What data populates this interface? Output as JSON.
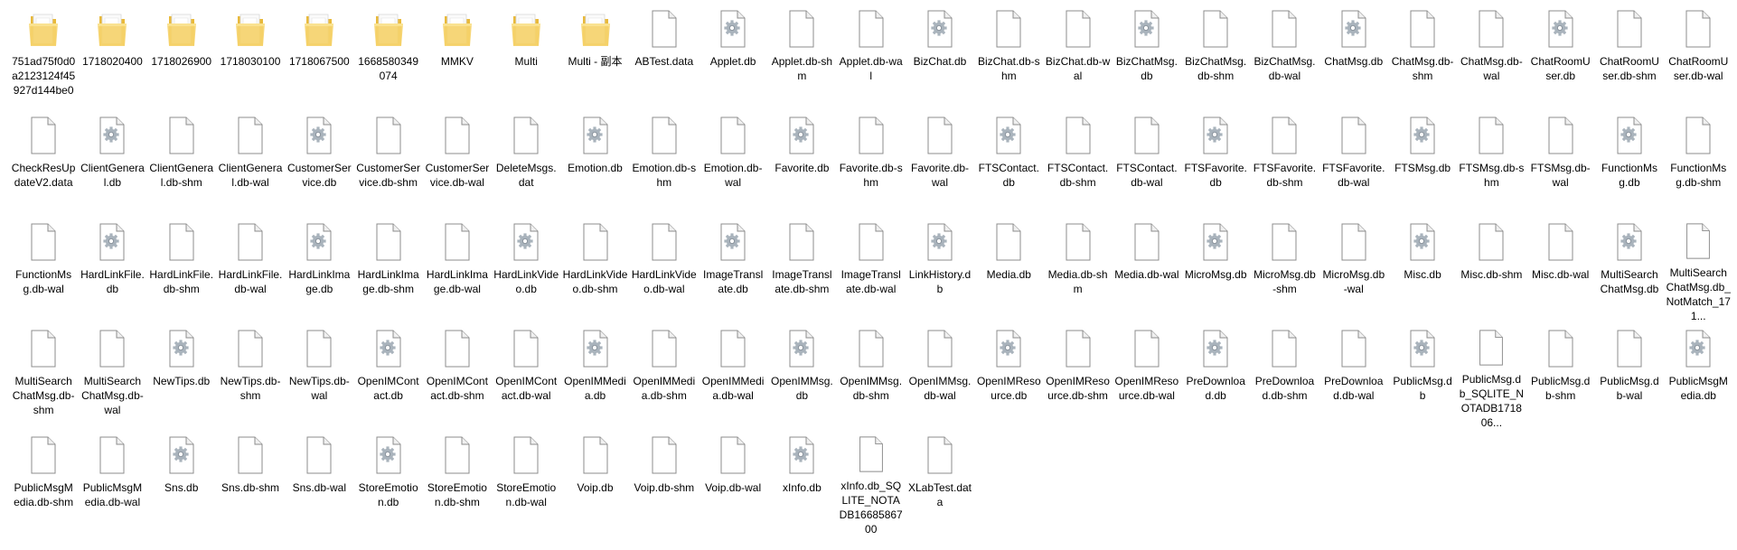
{
  "files": [
    {
      "name": "751ad75f0d0a2123124f45927d144be0",
      "type": "folder"
    },
    {
      "name": "1718020400",
      "type": "folder"
    },
    {
      "name": "1718026900",
      "type": "folder"
    },
    {
      "name": "1718030100",
      "type": "folder"
    },
    {
      "name": "1718067500",
      "type": "folder"
    },
    {
      "name": "1668580349074",
      "type": "folder"
    },
    {
      "name": "MMKV",
      "type": "folder"
    },
    {
      "name": "Multi",
      "type": "folder"
    },
    {
      "name": "Multi - 副本",
      "type": "folder"
    },
    {
      "name": "ABTest.data",
      "type": "file"
    },
    {
      "name": "Applet.db",
      "type": "db"
    },
    {
      "name": "Applet.db-shm",
      "type": "file"
    },
    {
      "name": "Applet.db-wal",
      "type": "file"
    },
    {
      "name": "BizChat.db",
      "type": "db"
    },
    {
      "name": "BizChat.db-shm",
      "type": "file"
    },
    {
      "name": "BizChat.db-wal",
      "type": "file"
    },
    {
      "name": "BizChatMsg.db",
      "type": "db"
    },
    {
      "name": "BizChatMsg.db-shm",
      "type": "file"
    },
    {
      "name": "BizChatMsg.db-wal",
      "type": "file"
    },
    {
      "name": "ChatMsg.db",
      "type": "db"
    },
    {
      "name": "ChatMsg.db-shm",
      "type": "file"
    },
    {
      "name": "ChatMsg.db-wal",
      "type": "file"
    },
    {
      "name": "ChatRoomUser.db",
      "type": "db"
    },
    {
      "name": "ChatRoomUser.db-shm",
      "type": "file"
    },
    {
      "name": "ChatRoomUser.db-wal",
      "type": "file"
    },
    {
      "name": "CheckResUpdateV2.data",
      "type": "file"
    },
    {
      "name": "ClientGeneral.db",
      "type": "db"
    },
    {
      "name": "ClientGeneral.db-shm",
      "type": "file"
    },
    {
      "name": "ClientGeneral.db-wal",
      "type": "file"
    },
    {
      "name": "CustomerService.db",
      "type": "db"
    },
    {
      "name": "CustomerService.db-shm",
      "type": "file"
    },
    {
      "name": "CustomerService.db-wal",
      "type": "file"
    },
    {
      "name": "DeleteMsgs.dat",
      "type": "file"
    },
    {
      "name": "Emotion.db",
      "type": "db"
    },
    {
      "name": "Emotion.db-shm",
      "type": "file"
    },
    {
      "name": "Emotion.db-wal",
      "type": "file"
    },
    {
      "name": "Favorite.db",
      "type": "db"
    },
    {
      "name": "Favorite.db-shm",
      "type": "file"
    },
    {
      "name": "Favorite.db-wal",
      "type": "file"
    },
    {
      "name": "FTSContact.db",
      "type": "db"
    },
    {
      "name": "FTSContact.db-shm",
      "type": "file"
    },
    {
      "name": "FTSContact.db-wal",
      "type": "file"
    },
    {
      "name": "FTSFavorite.db",
      "type": "db"
    },
    {
      "name": "FTSFavorite.db-shm",
      "type": "file"
    },
    {
      "name": "FTSFavorite.db-wal",
      "type": "file"
    },
    {
      "name": "FTSMsg.db",
      "type": "db"
    },
    {
      "name": "FTSMsg.db-shm",
      "type": "file"
    },
    {
      "name": "FTSMsg.db-wal",
      "type": "file"
    },
    {
      "name": "FunctionMsg.db",
      "type": "db"
    },
    {
      "name": "FunctionMsg.db-shm",
      "type": "file"
    },
    {
      "name": "FunctionMsg.db-wal",
      "type": "file"
    },
    {
      "name": "HardLinkFile.db",
      "type": "db"
    },
    {
      "name": "HardLinkFile.db-shm",
      "type": "file"
    },
    {
      "name": "HardLinkFile.db-wal",
      "type": "file"
    },
    {
      "name": "HardLinkImage.db",
      "type": "db"
    },
    {
      "name": "HardLinkImage.db-shm",
      "type": "file"
    },
    {
      "name": "HardLinkImage.db-wal",
      "type": "file"
    },
    {
      "name": "HardLinkVideo.db",
      "type": "db"
    },
    {
      "name": "HardLinkVideo.db-shm",
      "type": "file"
    },
    {
      "name": "HardLinkVideo.db-wal",
      "type": "file"
    },
    {
      "name": "ImageTranslate.db",
      "type": "db"
    },
    {
      "name": "ImageTranslate.db-shm",
      "type": "file"
    },
    {
      "name": "ImageTranslate.db-wal",
      "type": "file"
    },
    {
      "name": "LinkHistory.db",
      "type": "db"
    },
    {
      "name": "Media.db",
      "type": "file"
    },
    {
      "name": "Media.db-shm",
      "type": "file"
    },
    {
      "name": "Media.db-wal",
      "type": "file"
    },
    {
      "name": "MicroMsg.db",
      "type": "db"
    },
    {
      "name": "MicroMsg.db-shm",
      "type": "file"
    },
    {
      "name": "MicroMsg.db-wal",
      "type": "file"
    },
    {
      "name": "Misc.db",
      "type": "db"
    },
    {
      "name": "Misc.db-shm",
      "type": "file"
    },
    {
      "name": "Misc.db-wal",
      "type": "file"
    },
    {
      "name": "MultiSearchChatMsg.db",
      "type": "db"
    },
    {
      "name": "MultiSearchChatMsg.db_NotMatch_171...",
      "type": "file"
    },
    {
      "name": "MultiSearchChatMsg.db-shm",
      "type": "file"
    },
    {
      "name": "MultiSearchChatMsg.db-wal",
      "type": "file"
    },
    {
      "name": "NewTips.db",
      "type": "db"
    },
    {
      "name": "NewTips.db-shm",
      "type": "file"
    },
    {
      "name": "NewTips.db-wal",
      "type": "file"
    },
    {
      "name": "OpenIMContact.db",
      "type": "db"
    },
    {
      "name": "OpenIMContact.db-shm",
      "type": "file"
    },
    {
      "name": "OpenIMContact.db-wal",
      "type": "file"
    },
    {
      "name": "OpenIMMedia.db",
      "type": "db"
    },
    {
      "name": "OpenIMMedia.db-shm",
      "type": "file"
    },
    {
      "name": "OpenIMMedia.db-wal",
      "type": "file"
    },
    {
      "name": "OpenIMMsg.db",
      "type": "db"
    },
    {
      "name": "OpenIMMsg.db-shm",
      "type": "file"
    },
    {
      "name": "OpenIMMsg.db-wal",
      "type": "file"
    },
    {
      "name": "OpenIMResource.db",
      "type": "db"
    },
    {
      "name": "OpenIMResource.db-shm",
      "type": "file"
    },
    {
      "name": "OpenIMResource.db-wal",
      "type": "file"
    },
    {
      "name": "PreDownload.db",
      "type": "db"
    },
    {
      "name": "PreDownload.db-shm",
      "type": "file"
    },
    {
      "name": "PreDownload.db-wal",
      "type": "file"
    },
    {
      "name": "PublicMsg.db",
      "type": "db"
    },
    {
      "name": "PublicMsg.db_SQLITE_NOTADB171806...",
      "type": "file"
    },
    {
      "name": "PublicMsg.db-shm",
      "type": "file"
    },
    {
      "name": "PublicMsg.db-wal",
      "type": "file"
    },
    {
      "name": "PublicMsgMedia.db",
      "type": "db"
    },
    {
      "name": "PublicMsgMedia.db-shm",
      "type": "file"
    },
    {
      "name": "PublicMsgMedia.db-wal",
      "type": "file"
    },
    {
      "name": "Sns.db",
      "type": "db"
    },
    {
      "name": "Sns.db-shm",
      "type": "file"
    },
    {
      "name": "Sns.db-wal",
      "type": "file"
    },
    {
      "name": "StoreEmotion.db",
      "type": "db"
    },
    {
      "name": "StoreEmotion.db-shm",
      "type": "file"
    },
    {
      "name": "StoreEmotion.db-wal",
      "type": "file"
    },
    {
      "name": "Voip.db",
      "type": "file"
    },
    {
      "name": "Voip.db-shm",
      "type": "file"
    },
    {
      "name": "Voip.db-wal",
      "type": "file"
    },
    {
      "name": "xInfo.db",
      "type": "db"
    },
    {
      "name": "xInfo.db_SQLITE_NOTADB1668586700",
      "type": "file"
    },
    {
      "name": "XLabTest.data",
      "type": "file"
    }
  ]
}
